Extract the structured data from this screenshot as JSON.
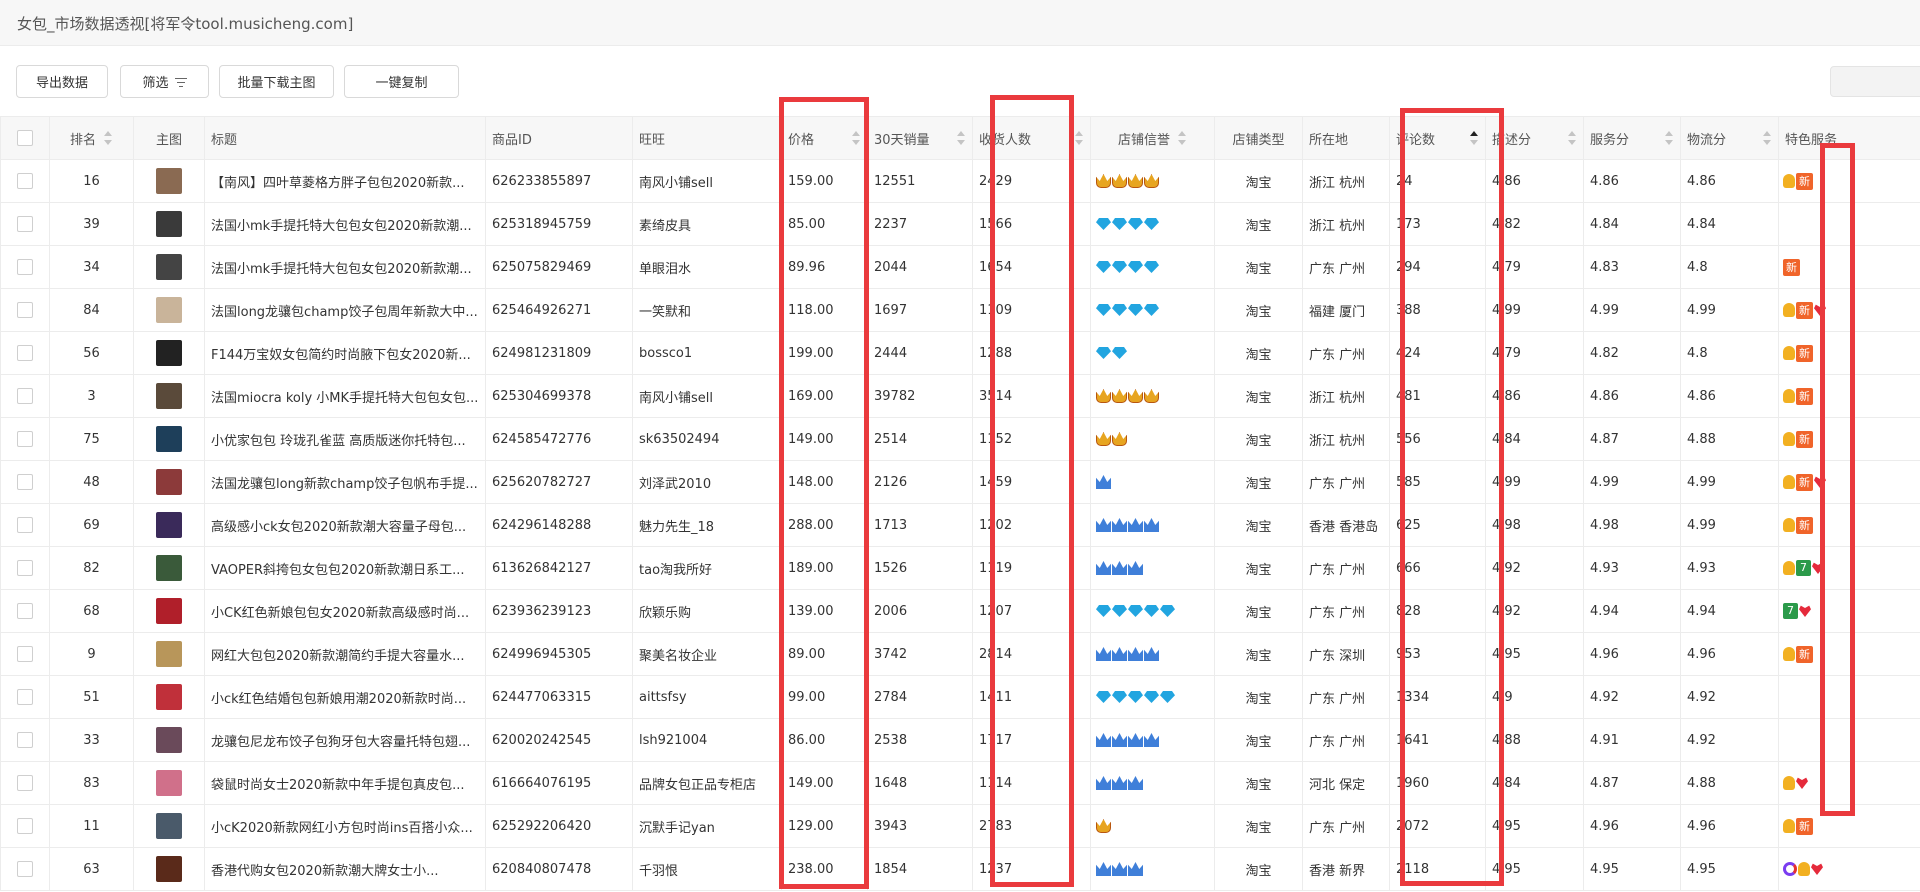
{
  "window": {
    "title": "女包_市场数据透视[将军令tool.musicheng.com]"
  },
  "toolbar": {
    "export_label": "导出数据",
    "filter_label": "筛选",
    "batch_download_label": "批量下载主图",
    "copy_label": "一键复制"
  },
  "columns": {
    "rank": "排名",
    "image": "主图",
    "title": "标题",
    "item_id": "商品ID",
    "wangwang": "旺旺",
    "price": "价格",
    "sales30": "30天销量",
    "buyers": "收货人数",
    "credit": "店铺信誉",
    "shop_type": "店铺类型",
    "location": "所在地",
    "reviews": "评论数",
    "desc_score": "描述分",
    "service_score": "服务分",
    "logistics_score": "物流分",
    "special": "特色服务"
  },
  "rows": [
    {
      "rank": "16",
      "title": "【南风】四叶草菱格方胖子包包2020新款...",
      "id": "626233855897",
      "wangwang": "南风小铺sell",
      "price": "159.00",
      "sales": "12551",
      "buyers": "2429",
      "credit": "crown-4",
      "type": "淘宝",
      "loc": "浙江 杭州",
      "reviews": "24",
      "desc": "4.86",
      "service": "4.86",
      "logistics": "4.86",
      "svc": [
        "gold",
        "new"
      ],
      "thumb": "#8a6a52"
    },
    {
      "rank": "39",
      "title": "法国小mk手提托特大包包女包2020新款潮...",
      "id": "625318945759",
      "wangwang": "素绮皮具",
      "price": "85.00",
      "sales": "2237",
      "buyers": "1566",
      "credit": "diamond-4",
      "type": "淘宝",
      "loc": "浙江 杭州",
      "reviews": "173",
      "desc": "4.82",
      "service": "4.84",
      "logistics": "4.84",
      "svc": [],
      "thumb": "#3a3a3a"
    },
    {
      "rank": "34",
      "title": "法国小mk手提托特大包包女包2020新款潮...",
      "id": "625075829469",
      "wangwang": "单眼泪水",
      "price": "89.96",
      "sales": "2044",
      "buyers": "1654",
      "credit": "diamond-4",
      "type": "淘宝",
      "loc": "广东 广州",
      "reviews": "294",
      "desc": "4.79",
      "service": "4.83",
      "logistics": "4.8",
      "svc": [
        "new"
      ],
      "thumb": "#444"
    },
    {
      "rank": "84",
      "title": "法国long龙骧包champ饺子包周年新款大中...",
      "id": "625464926271",
      "wangwang": "一笑默和",
      "price": "118.00",
      "sales": "1697",
      "buyers": "1109",
      "credit": "diamond-4",
      "type": "淘宝",
      "loc": "福建 厦门",
      "reviews": "388",
      "desc": "4.99",
      "service": "4.99",
      "logistics": "4.99",
      "svc": [
        "gold",
        "new",
        "heart"
      ],
      "thumb": "#c9b49a"
    },
    {
      "rank": "56",
      "title": "F144万宝奴女包简约时尚腋下包女2020新...",
      "id": "624981231809",
      "wangwang": "bossco1",
      "price": "199.00",
      "sales": "2444",
      "buyers": "1288",
      "credit": "diamond-2",
      "type": "淘宝",
      "loc": "广东 广州",
      "reviews": "424",
      "desc": "4.79",
      "service": "4.82",
      "logistics": "4.8",
      "svc": [
        "gold",
        "new"
      ],
      "thumb": "#222"
    },
    {
      "rank": "3",
      "title": "法国miocra koly 小MK手提托特大包包女包...",
      "id": "625304699378",
      "wangwang": "南风小铺sell",
      "price": "169.00",
      "sales": "39782",
      "buyers": "3514",
      "credit": "crown-4",
      "type": "淘宝",
      "loc": "浙江 杭州",
      "reviews": "481",
      "desc": "4.86",
      "service": "4.86",
      "logistics": "4.86",
      "svc": [
        "gold",
        "new"
      ],
      "thumb": "#5a4a3a"
    },
    {
      "rank": "75",
      "title": "小优家包包 玲珑孔雀蓝 高质版迷你托特包...",
      "id": "624585472776",
      "wangwang": "sk63502494",
      "price": "149.00",
      "sales": "2514",
      "buyers": "1152",
      "credit": "crown-2",
      "type": "淘宝",
      "loc": "浙江 杭州",
      "reviews": "556",
      "desc": "4.84",
      "service": "4.87",
      "logistics": "4.88",
      "svc": [
        "gold",
        "new"
      ],
      "thumb": "#1e3f5a"
    },
    {
      "rank": "48",
      "title": "法国龙骧包long新款champ饺子包帆布手提...",
      "id": "625620782727",
      "wangwang": "刘泽武2010",
      "price": "148.00",
      "sales": "2126",
      "buyers": "1459",
      "credit": "bluecrown-1",
      "type": "淘宝",
      "loc": "广东 广州",
      "reviews": "585",
      "desc": "4.99",
      "service": "4.99",
      "logistics": "4.99",
      "svc": [
        "gold",
        "new",
        "heart"
      ],
      "thumb": "#8c3a3a"
    },
    {
      "rank": "69",
      "title": "高级感小ck女包2020新款潮大容量子母包...",
      "id": "624296148288",
      "wangwang": "魅力先生_18",
      "price": "288.00",
      "sales": "1713",
      "buyers": "1202",
      "credit": "bluecrown-4",
      "type": "淘宝",
      "loc": "香港 香港岛",
      "reviews": "625",
      "desc": "4.98",
      "service": "4.98",
      "logistics": "4.99",
      "svc": [
        "gold",
        "new"
      ],
      "thumb": "#3a2a5a"
    },
    {
      "rank": "82",
      "title": "VAOPER斜挎包女包包2020新款潮日系工...",
      "id": "613626842127",
      "wangwang": "tao淘我所好",
      "price": "189.00",
      "sales": "1526",
      "buyers": "1119",
      "credit": "bluecrown-3",
      "type": "淘宝",
      "loc": "广东 广州",
      "reviews": "666",
      "desc": "4.92",
      "service": "4.93",
      "logistics": "4.93",
      "svc": [
        "gold",
        "seven",
        "heart"
      ],
      "thumb": "#3a5a3a"
    },
    {
      "rank": "68",
      "title": "小CK红色新娘包包女2020新款高级感时尚...",
      "id": "623936239123",
      "wangwang": "欣颖乐购",
      "price": "139.00",
      "sales": "2006",
      "buyers": "1207",
      "credit": "diamond-5",
      "type": "淘宝",
      "loc": "广东 广州",
      "reviews": "828",
      "desc": "4.92",
      "service": "4.94",
      "logistics": "4.94",
      "svc": [
        "seven",
        "heart"
      ],
      "thumb": "#b01f2a"
    },
    {
      "rank": "9",
      "title": "网红大包包2020新款潮简约手提大容量水...",
      "id": "624996945305",
      "wangwang": "聚美名妆企业",
      "price": "89.00",
      "sales": "3742",
      "buyers": "2814",
      "credit": "bluecrown-4",
      "type": "淘宝",
      "loc": "广东 深圳",
      "reviews": "953",
      "desc": "4.95",
      "service": "4.96",
      "logistics": "4.96",
      "svc": [
        "gold",
        "new"
      ],
      "thumb": "#b8965a"
    },
    {
      "rank": "51",
      "title": "小ck红色结婚包包新娘用潮2020新款时尚...",
      "id": "624477063315",
      "wangwang": "aittsfsy",
      "price": "99.00",
      "sales": "2784",
      "buyers": "1411",
      "credit": "diamond-5",
      "type": "淘宝",
      "loc": "广东 广州",
      "reviews": "1334",
      "desc": "4.9",
      "service": "4.92",
      "logistics": "4.92",
      "svc": [],
      "thumb": "#c0303a"
    },
    {
      "rank": "33",
      "title": "龙骧包尼龙布饺子包狗牙包大容量托特包翅...",
      "id": "620020242545",
      "wangwang": "lsh921004",
      "price": "86.00",
      "sales": "2538",
      "buyers": "1717",
      "credit": "bluecrown-4",
      "type": "淘宝",
      "loc": "广东 广州",
      "reviews": "1641",
      "desc": "4.88",
      "service": "4.91",
      "logistics": "4.92",
      "svc": [],
      "thumb": "#6a4a5a"
    },
    {
      "rank": "83",
      "title": "袋鼠时尚女士2020新款中年手提包真皮包...",
      "id": "616664076195",
      "wangwang": "品牌女包正品专柜店",
      "price": "149.00",
      "sales": "1648",
      "buyers": "1114",
      "credit": "bluecrown-3",
      "type": "淘宝",
      "loc": "河北 保定",
      "reviews": "1960",
      "desc": "4.84",
      "service": "4.87",
      "logistics": "4.88",
      "svc": [
        "gold",
        "heart"
      ],
      "thumb": "#d0708a"
    },
    {
      "rank": "11",
      "title": "小cK2020新款网红小方包时尚ins百搭小众...",
      "id": "625292206420",
      "wangwang": "沉默手记yan",
      "price": "129.00",
      "sales": "3943",
      "buyers": "2783",
      "credit": "crown-1",
      "type": "淘宝",
      "loc": "广东 广州",
      "reviews": "2072",
      "desc": "4.95",
      "service": "4.96",
      "logistics": "4.96",
      "svc": [
        "gold",
        "new"
      ],
      "thumb": "#4a5a6a"
    },
    {
      "rank": "63",
      "title": "香港代购女包2020新款潮大牌女士小...",
      "id": "620840807478",
      "wangwang": "千羽恨",
      "price": "238.00",
      "sales": "1854",
      "buyers": "1237",
      "credit": "bluecrown-3",
      "type": "淘宝",
      "loc": "香港 新界",
      "reviews": "2118",
      "desc": "4.95",
      "service": "4.95",
      "logistics": "4.95",
      "svc": [
        "ring",
        "gold",
        "heart"
      ],
      "thumb": "#5a2a1a"
    }
  ],
  "service_icons": {
    "gold": "gold-medal-icon",
    "new": "new-badge-icon",
    "heart": "heart-icon",
    "seven": "seven-day-return-icon",
    "ring": "ring-icon"
  },
  "svc_text": {
    "new": "新",
    "seven": "7"
  }
}
